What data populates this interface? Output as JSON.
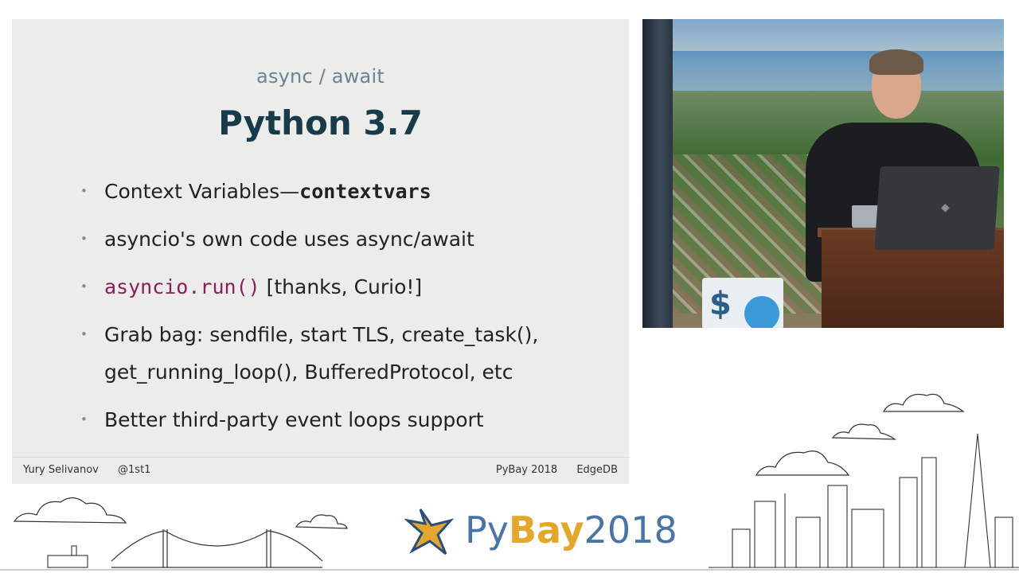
{
  "slide": {
    "subtitle": "async / await",
    "title": "Python 3.7",
    "bullets": {
      "b1_text": "Context Variables—",
      "b1_code": "contextvars",
      "b2": "asyncio's own code uses async/await",
      "b3_code": "asyncio.run()",
      "b3_text": " [thanks, Curio!]",
      "b4_line1": "Grab bag: sendfile, start TLS, create_task(),",
      "b4_line2": "get_running_loop(), BufferedProtocol, etc",
      "b5": "Better third-party event loops support"
    },
    "footer": {
      "author": "Yury Selivanov",
      "handle": "@1st1",
      "event": "PyBay 2018",
      "company": "EdgeDB"
    }
  },
  "video": {
    "sign_symbol": "$"
  },
  "brand": {
    "py": "Py",
    "bay": "Bay",
    "year": "2018",
    "colors": {
      "blue": "#4a74a8",
      "gold": "#e5a72a"
    }
  }
}
